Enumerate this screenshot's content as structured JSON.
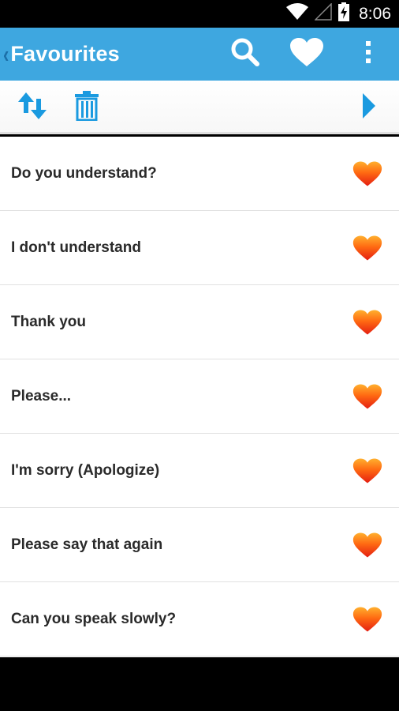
{
  "status_bar": {
    "time": "8:06"
  },
  "action_bar": {
    "title": "Favourites",
    "color": "#3ea7e0"
  },
  "toolbar": {
    "sort_icon": "sort-arrows-icon",
    "delete_icon": "trash-icon",
    "play_icon": "play-arrow-icon",
    "accent": "#1a9ae0"
  },
  "phrases": [
    {
      "text": "Do you understand?",
      "favourite": true
    },
    {
      "text": "I don't understand",
      "favourite": true
    },
    {
      "text": "Thank you",
      "favourite": true
    },
    {
      "text": "Please...",
      "favourite": true
    },
    {
      "text": "I'm sorry (Apologize)",
      "favourite": true
    },
    {
      "text": "Please say that again",
      "favourite": true
    },
    {
      "text": "Can you speak slowly?",
      "favourite": true
    }
  ]
}
